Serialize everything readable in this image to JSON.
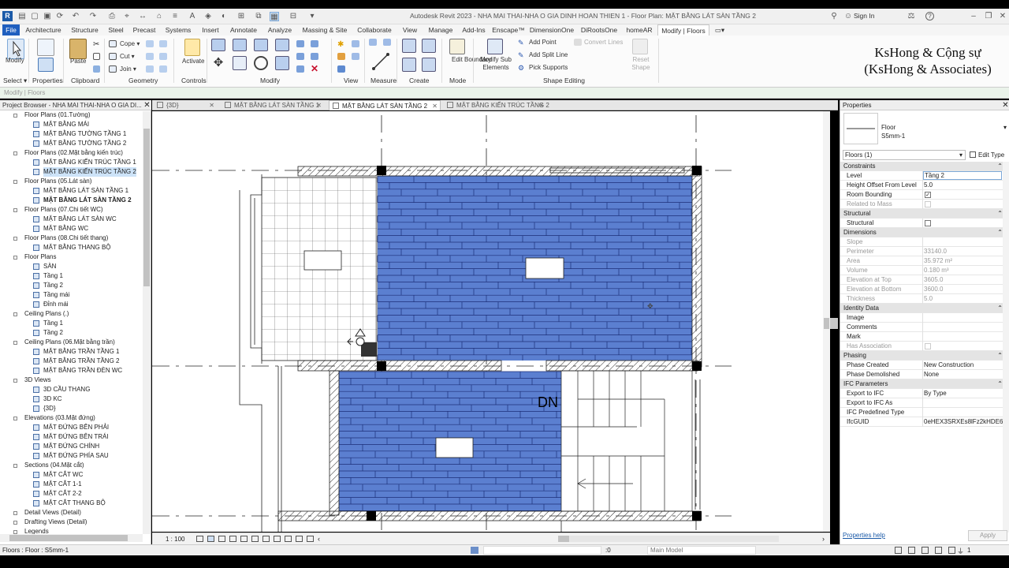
{
  "titlebar": {
    "title": "Autodesk Revit 2023 - NHA MAI THAI-NHA O GIA DINH HOAN THIEN 1 - Floor Plan: MẶT BẰNG LÁT SÀN TẦNG 2",
    "app_icon": "R",
    "sign_in": "Sign In",
    "help": "?"
  },
  "ribbon_tabs": [
    "File",
    "Architecture",
    "Structure",
    "Steel",
    "Precast",
    "Systems",
    "Insert",
    "Annotate",
    "Analyze",
    "Massing & Site",
    "Collaborate",
    "View",
    "Manage",
    "Add-Ins",
    "Enscape™",
    "DimensionOne",
    "DiRootsOne",
    "homeAR",
    "Modify | Floors"
  ],
  "ribbon": {
    "modify": "Modify",
    "select": "Select ▾",
    "properties": "Properties",
    "paste": "Paste",
    "clipboard": "Clipboard",
    "cope": "Cope ▾",
    "cut": "Cut ▾",
    "join": "Join ▾",
    "geometry": "Geometry",
    "activate": "Activate",
    "controls": "Controls",
    "modify_panel": "Modify",
    "view": "View",
    "measure": "Measure",
    "create": "Create",
    "edit_boundary": "Edit Boundary",
    "mode": "Mode",
    "modify_sub": "Modify Sub Elements",
    "add_point": "Add Point",
    "add_split_line": "Add Split Line",
    "pick_supports": "Pick Supports",
    "convert_lines": "Convert Lines",
    "reset_shape": "Reset Shape",
    "shape_editing": "Shape Editing"
  },
  "options_bar": "Modify | Floors",
  "watermark": {
    "line1": "KsHong & Cộng sự",
    "line2": "(KsHong & Associates)"
  },
  "project_browser": {
    "header": "Project Browser - NHA MAI THAI-NHA O GIA DI...",
    "items": [
      {
        "label": "Floor Plans (01.Tường)",
        "level": 1,
        "type": "group"
      },
      {
        "label": "MẶT BẰNG MÁI",
        "level": 2,
        "type": "view"
      },
      {
        "label": "MẶT BẰNG TƯỜNG TẦNG 1",
        "level": 2,
        "type": "view"
      },
      {
        "label": "MẶT BẰNG TƯỜNG TẦNG 2",
        "level": 2,
        "type": "view"
      },
      {
        "label": "Floor Plans (02.Mặt bằng kiến trúc)",
        "level": 1,
        "type": "group"
      },
      {
        "label": "MẶT BẰNG KIẾN TRÚC TẦNG 1",
        "level": 2,
        "type": "view"
      },
      {
        "label": "MẶT BẰNG KIẾN TRÚC TẦNG 2",
        "level": 2,
        "type": "view",
        "selected": true
      },
      {
        "label": "Floor Plans (05.Lát sàn)",
        "level": 1,
        "type": "group"
      },
      {
        "label": "MẶT BẰNG LÁT SÀN TẦNG 1",
        "level": 2,
        "type": "view"
      },
      {
        "label": "MẶT BẰNG LÁT SÀN TẦNG 2",
        "level": 2,
        "type": "view",
        "bold": true
      },
      {
        "label": "Floor Plans (07.Chi tiết WC)",
        "level": 1,
        "type": "group"
      },
      {
        "label": "MẶT BẰNG LÁT SÀN WC",
        "level": 2,
        "type": "view"
      },
      {
        "label": "MẶT BẰNG WC",
        "level": 2,
        "type": "view"
      },
      {
        "label": "Floor Plans (08.Chi tiết thang)",
        "level": 1,
        "type": "group"
      },
      {
        "label": "MẶT BẰNG THANG BỘ",
        "level": 2,
        "type": "view"
      },
      {
        "label": "Floor Plans",
        "level": 1,
        "type": "group"
      },
      {
        "label": "SÀN",
        "level": 2,
        "type": "view"
      },
      {
        "label": "Tầng 1",
        "level": 2,
        "type": "view"
      },
      {
        "label": "Tầng 2",
        "level": 2,
        "type": "view"
      },
      {
        "label": "Tầng mái",
        "level": 2,
        "type": "view"
      },
      {
        "label": "Đỉnh mái",
        "level": 2,
        "type": "view"
      },
      {
        "label": "Ceiling Plans (.)",
        "level": 1,
        "type": "group"
      },
      {
        "label": "Tầng 1",
        "level": 2,
        "type": "view"
      },
      {
        "label": "Tầng 2",
        "level": 2,
        "type": "view"
      },
      {
        "label": "Ceiling Plans (06.Mặt bằng trần)",
        "level": 1,
        "type": "group"
      },
      {
        "label": "MẶT BẰNG TRẦN TẦNG 1",
        "level": 2,
        "type": "view"
      },
      {
        "label": "MẶT BẰNG TRẦN TẦNG 2",
        "level": 2,
        "type": "view"
      },
      {
        "label": "MẶT BẰNG TRẦN ĐÈN WC",
        "level": 2,
        "type": "view"
      },
      {
        "label": "3D Views",
        "level": 1,
        "type": "group"
      },
      {
        "label": "3D CẦU THANG",
        "level": 2,
        "type": "view"
      },
      {
        "label": "3D KC",
        "level": 2,
        "type": "view"
      },
      {
        "label": "{3D}",
        "level": 2,
        "type": "view"
      },
      {
        "label": "Elevations (03.Mặt đứng)",
        "level": 1,
        "type": "group"
      },
      {
        "label": "MẶT ĐỨNG BÊN PHẢI",
        "level": 2,
        "type": "view"
      },
      {
        "label": "MẶT ĐỨNG BÊN TRÁI",
        "level": 2,
        "type": "view"
      },
      {
        "label": "MẶT ĐỨNG CHÍNH",
        "level": 2,
        "type": "view"
      },
      {
        "label": "MẶT ĐỨNG PHÍA SAU",
        "level": 2,
        "type": "view"
      },
      {
        "label": "Sections (04.Mặt cắt)",
        "level": 1,
        "type": "group"
      },
      {
        "label": "MẶT CẮT WC",
        "level": 2,
        "type": "view"
      },
      {
        "label": "MẶT CẮT 1-1",
        "level": 2,
        "type": "view"
      },
      {
        "label": "MẶT CẮT 2-2",
        "level": 2,
        "type": "view"
      },
      {
        "label": "MẶT CẮT THANG BỘ",
        "level": 2,
        "type": "view"
      },
      {
        "label": "Detail Views (Detail)",
        "level": 1,
        "type": "collapsed"
      },
      {
        "label": "Drafting Views (Detail)",
        "level": 1,
        "type": "collapsed"
      },
      {
        "label": "Legends",
        "level": 1,
        "type": "collapsed"
      }
    ]
  },
  "view_tabs": [
    {
      "label": "{3D}",
      "active": false
    },
    {
      "label": "MẶT BẰNG LÁT SÀN TẦNG 1",
      "active": false
    },
    {
      "label": "MẶT BẰNG LÁT SÀN TẦNG 2",
      "active": true
    },
    {
      "label": "MẶT BẰNG KIẾN TRÚC TẦNG 2",
      "active": false
    }
  ],
  "canvas": {
    "label_dn": "DN",
    "floor_color": "#5b7fd0",
    "tile_line_color": "#1c2f78"
  },
  "view_status": {
    "scale": "1 : 100"
  },
  "properties": {
    "header": "Properties",
    "type_family": "Floor",
    "type_name": "S5mm-1",
    "selector": "Floors (1)",
    "edit_type": "Edit Type",
    "help": "Properties help",
    "apply": "Apply",
    "rows": [
      {
        "k": "Constraints",
        "group": true
      },
      {
        "k": "Level",
        "v": "Tầng 2"
      },
      {
        "k": "Height Offset From Level",
        "v": "5.0"
      },
      {
        "k": "Room Bounding",
        "v": "",
        "check": "on"
      },
      {
        "k": "Related to Mass",
        "v": "",
        "check": "off",
        "dis": true
      },
      {
        "k": "Structural",
        "group": true
      },
      {
        "k": "Structural",
        "v": "",
        "check": "off"
      },
      {
        "k": "Dimensions",
        "group": true
      },
      {
        "k": "Slope",
        "v": "",
        "dis": true
      },
      {
        "k": "Perimeter",
        "v": "33140.0",
        "dis": true
      },
      {
        "k": "Area",
        "v": "35.972 m²",
        "dis": true
      },
      {
        "k": "Volume",
        "v": "0.180 m³",
        "dis": true
      },
      {
        "k": "Elevation at Top",
        "v": "3605.0",
        "dis": true
      },
      {
        "k": "Elevation at Bottom",
        "v": "3600.0",
        "dis": true
      },
      {
        "k": "Thickness",
        "v": "5.0",
        "dis": true
      },
      {
        "k": "Identity Data",
        "group": true
      },
      {
        "k": "Image",
        "v": ""
      },
      {
        "k": "Comments",
        "v": ""
      },
      {
        "k": "Mark",
        "v": ""
      },
      {
        "k": "Has Association",
        "v": "",
        "check": "off",
        "dis": true
      },
      {
        "k": "Phasing",
        "group": true
      },
      {
        "k": "Phase Created",
        "v": "New Construction"
      },
      {
        "k": "Phase Demolished",
        "v": "None"
      },
      {
        "k": "IFC Parameters",
        "group": true
      },
      {
        "k": "Export to IFC",
        "v": "By Type"
      },
      {
        "k": "Export to IFC As",
        "v": ""
      },
      {
        "k": "IFC Predefined Type",
        "v": ""
      },
      {
        "k": "IfcGUID",
        "v": "0eHEX3SRXEs8lFz2kHDE6X"
      }
    ]
  },
  "statusbar": {
    "text": "Floors : Floor : S5mm-1",
    "count": ":0",
    "model": "Main Model",
    "filter": "1"
  }
}
